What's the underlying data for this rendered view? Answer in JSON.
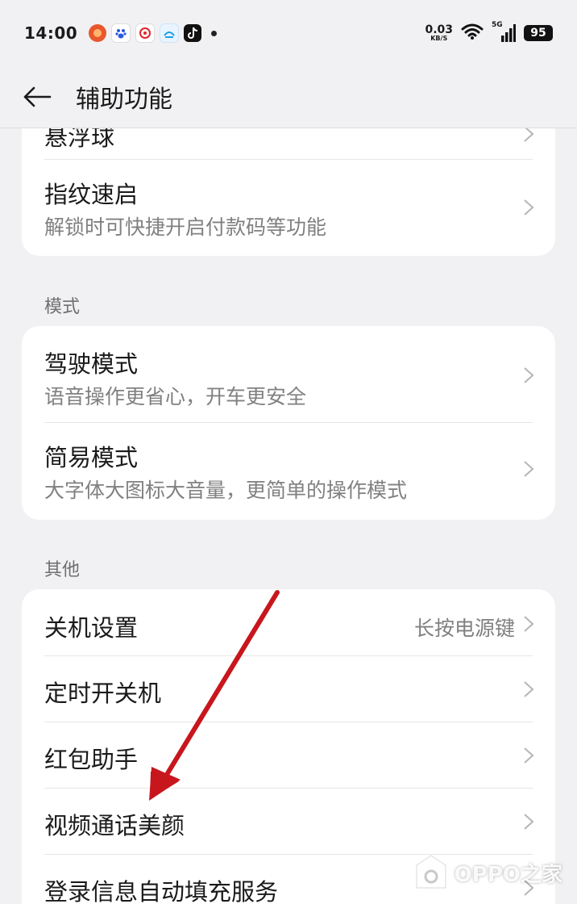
{
  "status_bar": {
    "time": "14:00",
    "net_speed_value": "0.03",
    "net_speed_unit": "KB/S",
    "network": "5G",
    "battery": "95"
  },
  "header": {
    "title": "辅助功能"
  },
  "sections": {
    "top_card": {
      "partial_title": "悬浮球",
      "items": [
        {
          "title": "指纹速启",
          "subtitle": "解锁时可快捷开启付款码等功能"
        }
      ]
    },
    "mode": {
      "label": "模式",
      "items": [
        {
          "title": "驾驶模式",
          "subtitle": "语音操作更省心，开车更安全"
        },
        {
          "title": "简易模式",
          "subtitle": "大字体大图标大音量，更简单的操作模式"
        }
      ]
    },
    "other": {
      "label": "其他",
      "items": [
        {
          "title": "关机设置",
          "value": "长按电源键"
        },
        {
          "title": "定时开关机"
        },
        {
          "title": "红包助手"
        },
        {
          "title": "视频通话美颜"
        },
        {
          "title": "登录信息自动填充服务"
        }
      ]
    }
  },
  "watermark": {
    "text": "OPPO之家"
  },
  "colors": {
    "background": "#f1f1f3",
    "card": "#ffffff",
    "annotation_arrow": "#c8161d"
  }
}
